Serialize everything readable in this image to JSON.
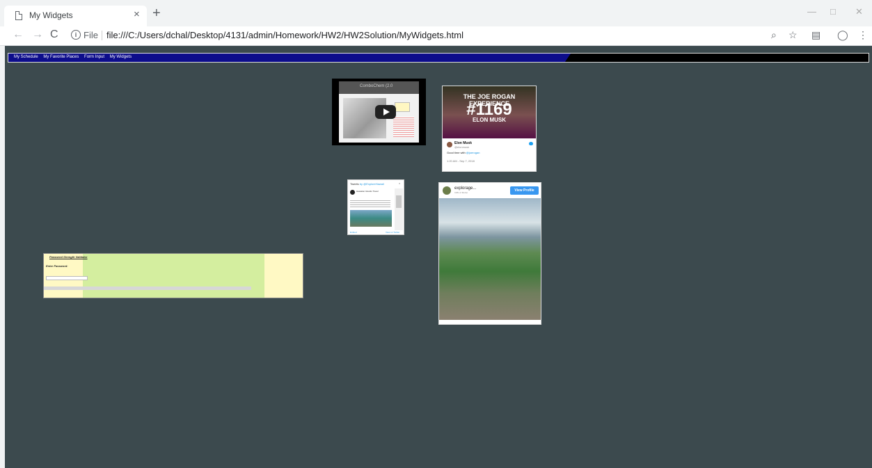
{
  "browser": {
    "tab_title": "My Widgets",
    "tab_close": "×",
    "new_tab": "+",
    "scheme_label": "File",
    "url": "file:///C:/Users/dchal/Desktop/4131/admin/Homework/HW2/HW2Solution/MyWidgets.html",
    "icons": [
      "back-icon",
      "forward-icon",
      "reload-icon",
      "info-icon",
      "zoom-icon",
      "star-icon",
      "extension-icon",
      "profile-icon",
      "menu-icon"
    ]
  },
  "nav": {
    "links": [
      "My Schedule",
      "My Favorite Places",
      "Form Input",
      "My Widgets"
    ]
  },
  "youtube": {
    "channel_title": "ComboChem (2.0",
    "subtitle": "Schrodinger Didn't Straight arise"
  },
  "tweet": {
    "image_heading": "THE JOE ROGAN EXPERIENCE",
    "image_number": "#1169",
    "image_name": "ELON MUSK",
    "author": "Elon Musk",
    "handle": "@elonmusk",
    "body_prefix": "Good time with ",
    "body_link": "@joerogan",
    "time": "1:20 AM - Sep 7, 2018"
  },
  "timeline": {
    "title": "Tweets",
    "by": "by @ExploreHawaii",
    "close": "×",
    "account": "Hawaiian Islands Travel",
    "embed": "Embed",
    "view": "View on Twitter"
  },
  "instagram": {
    "user": "explorage...",
    "location": "Cliffs of Moher",
    "button": "View Profile"
  },
  "password": {
    "title": "Password Strength Validator",
    "label": "Enter Password:"
  }
}
